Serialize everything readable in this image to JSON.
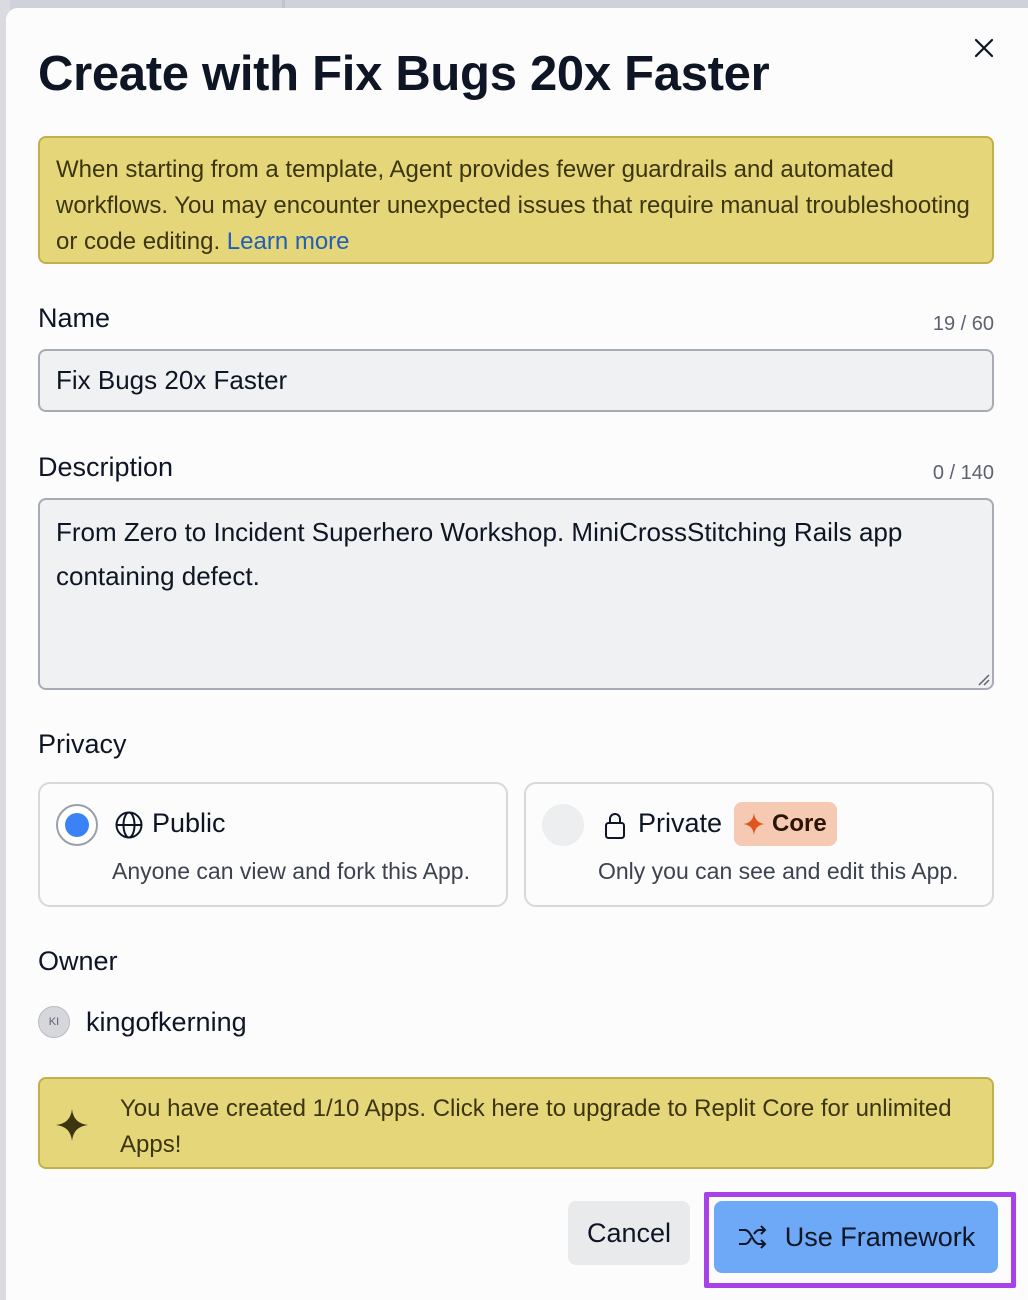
{
  "dialog": {
    "title": "Create with Fix Bugs 20x Faster",
    "close_icon": "close-icon"
  },
  "warning": {
    "text": "When starting from a template, Agent provides fewer guardrails and automated workflows. You may encounter unexpected issues that require manual troubleshooting or code editing.",
    "link": "Learn more"
  },
  "name": {
    "label": "Name",
    "counter": "19 / 60",
    "value": "Fix Bugs 20x Faster"
  },
  "description": {
    "label": "Description",
    "counter": "0 / 140",
    "value": "From Zero to Incident Superhero Workshop. MiniCrossStitching Rails app containing defect."
  },
  "privacy": {
    "label": "Privacy",
    "selected": "Public",
    "options": [
      {
        "title": "Public",
        "description": "Anyone can view and fork this App.",
        "icon": "globe-icon"
      },
      {
        "title": "Private",
        "description": "Only you can see and edit this App.",
        "icon": "lock-icon",
        "badge": "Core"
      }
    ]
  },
  "owner": {
    "label": "Owner",
    "initials": "KI",
    "username": "kingofkerning"
  },
  "upgrade": {
    "text": "You have created 1/10 Apps. Click here to upgrade to Replit Core for unlimited Apps!",
    "icon": "sparkle-icon"
  },
  "actions": {
    "cancel": "Cancel",
    "primary": "Use Framework",
    "primary_icon": "shuffle-icon"
  },
  "colors": {
    "accent": "#6ea9f7",
    "warning_bg": "#e6d67a",
    "highlight": "#a742e8",
    "core_badge": "#f6c9b3"
  }
}
